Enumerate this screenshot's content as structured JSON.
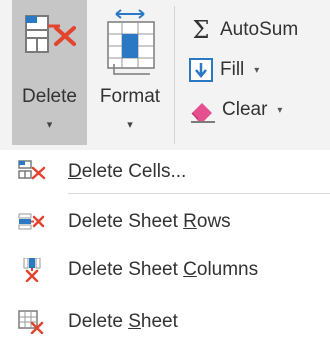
{
  "ribbon": {
    "delete": {
      "label": "Delete",
      "caret": "▾",
      "icon": "delete-cells-icon"
    },
    "format": {
      "label": "Format",
      "caret": "▾",
      "icon": "format-cells-icon"
    },
    "autosum": {
      "label": "AutoSum",
      "icon": "sigma-icon",
      "glyph": "Σ"
    },
    "fill": {
      "label": "Fill",
      "caret": "▾",
      "icon": "fill-down-icon"
    },
    "clear": {
      "label": "Clear",
      "caret": "▾",
      "icon": "eraser-icon"
    }
  },
  "menu": {
    "items": [
      {
        "pre": "",
        "key": "D",
        "post": "elete Cells...",
        "icon": "delete-cells-icon"
      },
      {
        "pre": "Delete Sheet ",
        "key": "R",
        "post": "ows",
        "icon": "delete-sheet-rows-icon"
      },
      {
        "pre": "Delete Sheet ",
        "key": "C",
        "post": "olumns",
        "icon": "delete-sheet-columns-icon"
      },
      {
        "pre": "Delete ",
        "key": "S",
        "post": "heet",
        "icon": "delete-sheet-icon"
      }
    ]
  },
  "colors": {
    "ribbon_bg": "#f3f3f3",
    "selected_button": "#c6c6c6",
    "accent_blue": "#2b78c5",
    "delete_red": "#e2442e"
  }
}
